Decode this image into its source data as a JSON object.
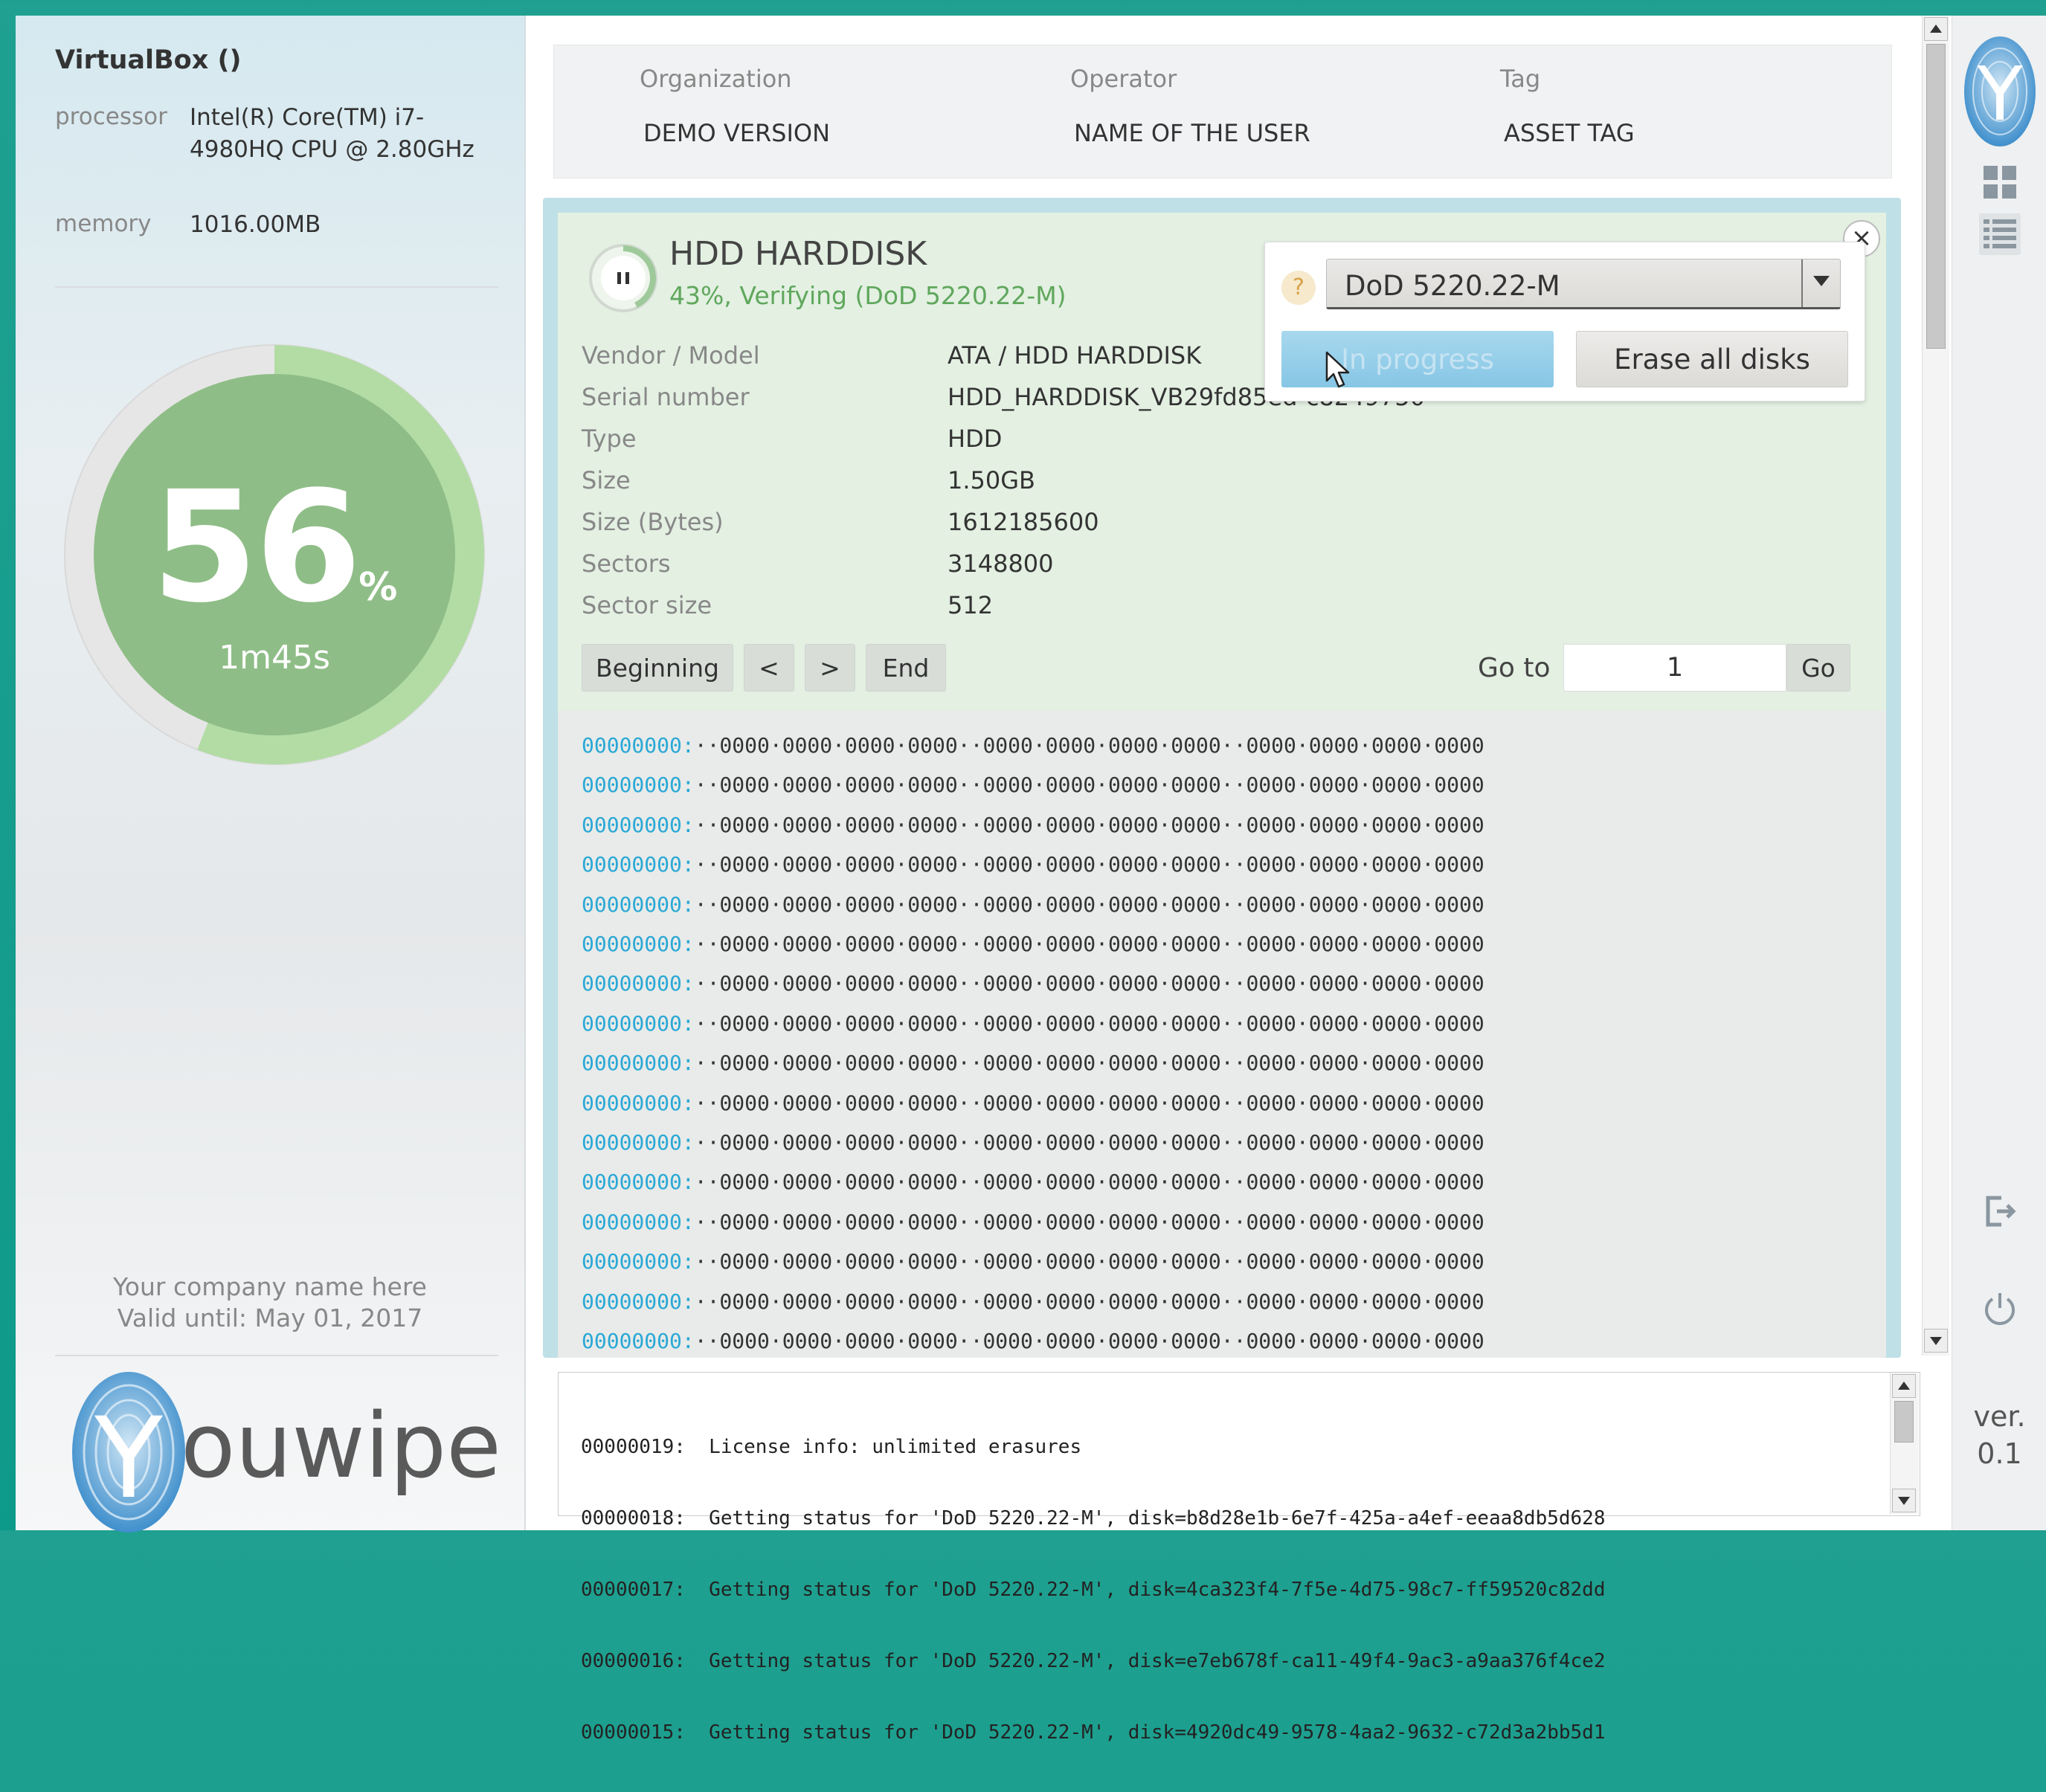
{
  "system": {
    "title": "VirtualBox ()",
    "processor_label": "processor",
    "processor_value": "Intel(R) Core(TM) i7-4980HQ CPU @ 2.80GHz",
    "memory_label": "memory",
    "memory_value": "1016.00MB"
  },
  "progress": {
    "percent": "56",
    "percent_fraction": 0.56,
    "percent_sign": "%",
    "elapsed": "1m45s"
  },
  "license": {
    "company": "Your company name here",
    "valid_until": "Valid until: May 01, 2017"
  },
  "brand": {
    "logo_text": "ouwipe",
    "logo_initial": "Y"
  },
  "info_bar": [
    {
      "label": "Organization",
      "value": "DEMO VERSION"
    },
    {
      "label": "Operator",
      "value": "NAME OF THE USER"
    },
    {
      "label": "Tag",
      "value": "ASSET TAG"
    }
  ],
  "disk": {
    "name": "HDD HARDDISK",
    "status": "43%, Verifying (DoD 5220.22-M)",
    "status_fraction": 0.43,
    "fields": [
      {
        "label": "Vendor / Model",
        "value": "ATA / HDD HARDDISK"
      },
      {
        "label": "Serial number",
        "value": "HDD_HARDDISK_VB29fd85ed-c8249750"
      },
      {
        "label": "Type",
        "value": "HDD"
      },
      {
        "label": "Size",
        "value": "1.50GB"
      },
      {
        "label": "Size (Bytes)",
        "value": "1612185600"
      },
      {
        "label": "Sectors",
        "value": "3148800"
      },
      {
        "label": "Sector size",
        "value": "512"
      }
    ]
  },
  "navigation": {
    "beginning": "Beginning",
    "prev": "<",
    "next": ">",
    "end": "End",
    "goto_label": "Go to",
    "goto_value": "1",
    "go": "Go"
  },
  "hex": {
    "address": "00000000:",
    "data": "··0000·0000·0000·0000··0000·0000·0000·0000··0000·0000·0000·0000",
    "row_count": 16
  },
  "popup": {
    "help": "?",
    "method": "DoD 5220.22-M",
    "in_progress": "In progress",
    "erase_all": "Erase all disks",
    "close": "×"
  },
  "log": [
    "00000019:  License info: unlimited erasures",
    "00000018:  Getting status for 'DoD 5220.22-M', disk=b8d28e1b-6e7f-425a-a4ef-eeaa8db5d628",
    "00000017:  Getting status for 'DoD 5220.22-M', disk=4ca323f4-7f5e-4d75-98c7-ff59520c82dd",
    "00000016:  Getting status for 'DoD 5220.22-M', disk=e7eb678f-ca11-49f4-9ac3-a9aa376f4ce2",
    "00000015:  Getting status for 'DoD 5220.22-M', disk=4920dc49-9578-4aa2-9632-c72d3a2bb5d1"
  ],
  "sidebar": {
    "version_label": "ver.",
    "version_number": "0.1",
    "icons": [
      "grid-view-icon",
      "list-view-icon",
      "logout-icon",
      "power-icon"
    ]
  },
  "colors": {
    "accent_green": "#a8d49b",
    "gauge_green": "#8fbd87",
    "status_green": "#5fa75c",
    "hex_address_blue": "#2aa8d6",
    "progress_button_blue": "#86c6e5",
    "window_teal": "#0e9a8a"
  }
}
